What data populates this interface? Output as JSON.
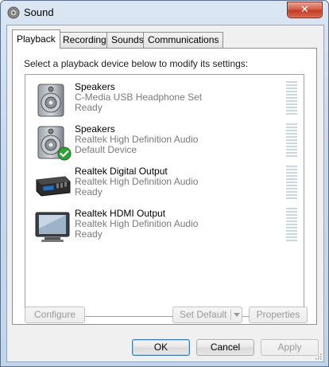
{
  "window": {
    "title": "Sound",
    "close_glyph": "✕"
  },
  "tabs": [
    {
      "label": "Playback",
      "active": true
    },
    {
      "label": "Recording",
      "active": false
    },
    {
      "label": "Sounds",
      "active": false
    },
    {
      "label": "Communications",
      "active": false
    }
  ],
  "playback": {
    "instruction": "Select a playback device below to modify its settings:",
    "devices": [
      {
        "name": "Speakers",
        "description": "C-Media USB Headphone Set",
        "status": "Ready",
        "icon": "speaker-icon",
        "is_default": false
      },
      {
        "name": "Speakers",
        "description": "Realtek High Definition Audio",
        "status": "Default Device",
        "icon": "speaker-icon",
        "is_default": true
      },
      {
        "name": "Realtek Digital Output",
        "description": "Realtek High Definition Audio",
        "status": "Ready",
        "icon": "digital-output-icon",
        "is_default": false
      },
      {
        "name": "Realtek HDMI Output",
        "description": "Realtek High Definition Audio",
        "status": "Ready",
        "icon": "monitor-icon",
        "is_default": false
      }
    ],
    "buttons": {
      "configure": "Configure",
      "set_default": "Set Default",
      "properties": "Properties"
    }
  },
  "dialog_buttons": {
    "ok": "OK",
    "cancel": "Cancel",
    "apply": "Apply"
  },
  "colors": {
    "accent_border": "#3c7fb1",
    "default_check": "#2fa33a",
    "level_meter": "#c8d7e1"
  }
}
